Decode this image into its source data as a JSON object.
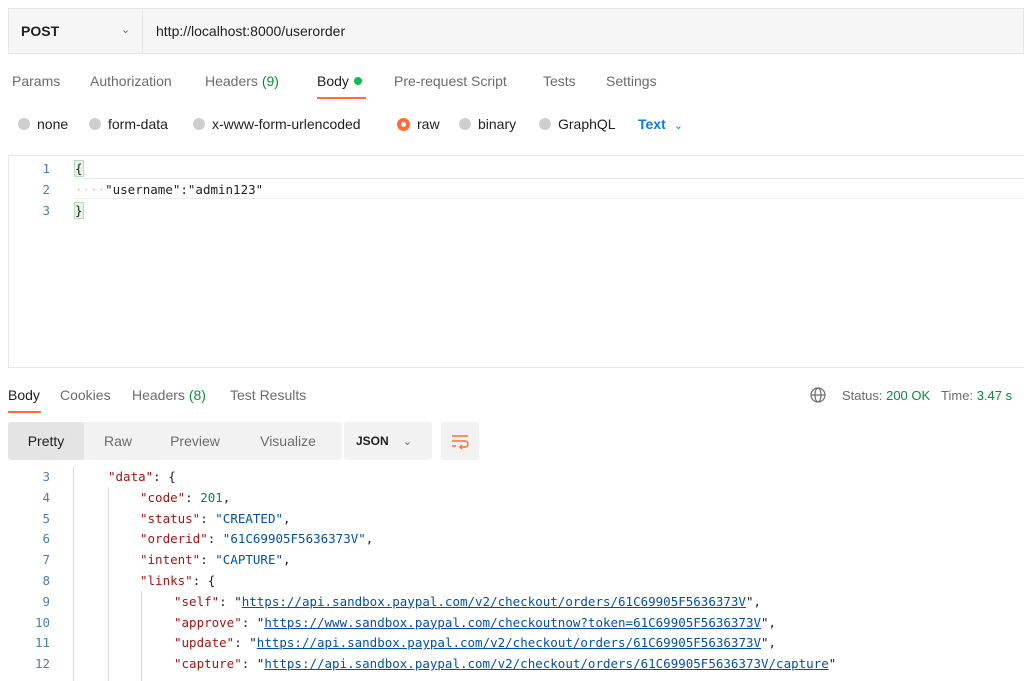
{
  "request": {
    "method": "POST",
    "url": "http://localhost:8000/userorder"
  },
  "request_tabs": {
    "params": "Params",
    "authorization": "Authorization",
    "headers": "Headers",
    "headers_count": "(9)",
    "body": "Body",
    "prerequest": "Pre-request Script",
    "tests": "Tests",
    "settings": "Settings"
  },
  "body_types": {
    "none": "none",
    "form_data": "form-data",
    "urlencoded": "x-www-form-urlencoded",
    "raw": "raw",
    "binary": "binary",
    "graphql": "GraphQL",
    "selected": "raw",
    "text_type": "Text"
  },
  "request_body": {
    "line_numbers": [
      "1",
      "2",
      "3"
    ],
    "open": "{",
    "key": "\"username\"",
    "colon": ":",
    "value": "\"admin123\"",
    "close": "}"
  },
  "response_tabs": {
    "body": "Body",
    "cookies": "Cookies",
    "headers": "Headers",
    "headers_count": "(8)",
    "test_results": "Test Results"
  },
  "response_status": {
    "status_label": "Status:",
    "status_value": "200 OK",
    "time_label": "Time:",
    "time_value": "3.47 s"
  },
  "view_modes": {
    "pretty": "Pretty",
    "raw": "Raw",
    "preview": "Preview",
    "visualize": "Visualize",
    "format": "JSON"
  },
  "response_body": {
    "line_numbers": [
      "3",
      "4",
      "5",
      "6",
      "7",
      "8",
      "9",
      "10",
      "11",
      "12"
    ],
    "data_key": "\"data\"",
    "code_key": "\"code\"",
    "code_value": "201",
    "status_key": "\"status\"",
    "status_value": "\"CREATED\"",
    "orderid_key": "\"orderid\"",
    "orderid_value": "\"61C69905F5636373V\"",
    "intent_key": "\"intent\"",
    "intent_value": "\"CAPTURE\"",
    "links_key": "\"links\"",
    "self_key": "\"self\"",
    "self_value": "https://api.sandbox.paypal.com/v2/checkout/orders/61C69905F5636373V",
    "approve_key": "\"approve\"",
    "approve_value": "https://www.sandbox.paypal.com/checkoutnow?token=61C69905F5636373V",
    "update_key": "\"update\"",
    "update_value": "https://api.sandbox.paypal.com/v2/checkout/orders/61C69905F5636373V",
    "capture_key": "\"capture\"",
    "capture_value": "https://api.sandbox.paypal.com/v2/checkout/orders/61C69905F5636373V/capture"
  },
  "colors": {
    "accent": "#ff6c37",
    "link": "#097bed",
    "success": "#0c8b3c"
  }
}
